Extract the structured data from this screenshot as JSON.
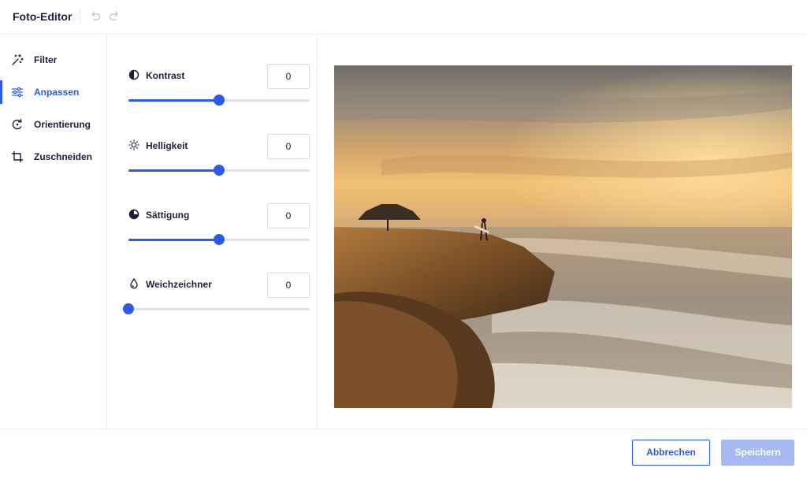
{
  "header": {
    "title": "Foto-Editor",
    "undo_icon": "undo-icon",
    "redo_icon": "redo-icon"
  },
  "sidebar": {
    "items": [
      {
        "label": "Filter",
        "icon": "magic-wand-icon",
        "active": false
      },
      {
        "label": "Anpassen",
        "icon": "sliders-icon",
        "active": true
      },
      {
        "label": "Orientierung",
        "icon": "rotate-icon",
        "active": false
      },
      {
        "label": "Zuschneiden",
        "icon": "crop-icon",
        "active": false
      }
    ]
  },
  "adjustments": [
    {
      "label": "Kontrast",
      "icon": "contrast-icon",
      "value": "0",
      "slider_fraction": 0.5
    },
    {
      "label": "Helligkeit",
      "icon": "brightness-icon",
      "value": "0",
      "slider_fraction": 0.5
    },
    {
      "label": "Sättigung",
      "icon": "saturation-icon",
      "value": "0",
      "slider_fraction": 0.5
    },
    {
      "label": "Weichzeichner",
      "icon": "drop-icon",
      "value": "0",
      "slider_fraction": 0.0
    }
  ],
  "footer": {
    "cancel_label": "Abbrechen",
    "save_label": "Speichern"
  },
  "colors": {
    "accent": "#2c5ae9",
    "accent_disabled": "#a7b9f3",
    "text": "#1b1f3b"
  }
}
